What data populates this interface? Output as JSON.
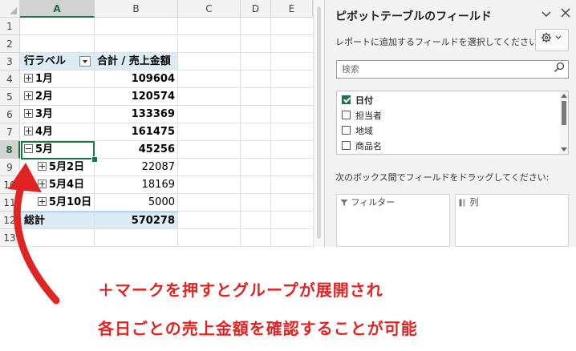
{
  "sheet": {
    "columns": [
      "A",
      "B",
      "C",
      "D",
      "E"
    ],
    "rows": [
      "1",
      "2",
      "3",
      "4",
      "5",
      "6",
      "7",
      "8",
      "9",
      "10",
      "11",
      "12",
      "13"
    ],
    "pivot_header": {
      "row_label": "行ラベル",
      "value_label": "合計 / 売上金額"
    },
    "pivot_rows": [
      {
        "label": "1月",
        "value": "109604",
        "state": "collapsed"
      },
      {
        "label": "2月",
        "value": "120574",
        "state": "collapsed"
      },
      {
        "label": "3月",
        "value": "133369",
        "state": "collapsed"
      },
      {
        "label": "4月",
        "value": "161475",
        "state": "collapsed"
      },
      {
        "label": "5月",
        "value": "45256",
        "state": "expanded"
      },
      {
        "label": "5月2日",
        "value": "22087",
        "state": "child"
      },
      {
        "label": "5月4日",
        "value": "18169",
        "state": "child"
      },
      {
        "label": "5月10日",
        "value": "5000",
        "state": "child"
      }
    ],
    "grand_total": {
      "label": "総計",
      "value": "570278"
    },
    "active_cell": "A8"
  },
  "pane": {
    "title": "ピボットテーブルのフィールド",
    "subtitle": "レポートに追加するフィールドを選択してください:",
    "search_placeholder": "検索",
    "fields": [
      {
        "label": "日付",
        "checked": true
      },
      {
        "label": "担当者",
        "checked": false
      },
      {
        "label": "地域",
        "checked": false
      },
      {
        "label": "商品名",
        "checked": false
      }
    ],
    "drag_hint": "次のボックス間でフィールドをドラッグしてください:",
    "areas": {
      "filter": "フィルター",
      "columns": "列"
    },
    "icons": {
      "dropdown": "chevron-down-icon",
      "close": "close-icon",
      "settings": "gear-icon",
      "search": "search-icon"
    }
  },
  "annotation": {
    "line1": "＋マークを押すとグループが展開され",
    "line2": "各日ごとの売上金額を確認することが可能",
    "color": "#e02424"
  }
}
